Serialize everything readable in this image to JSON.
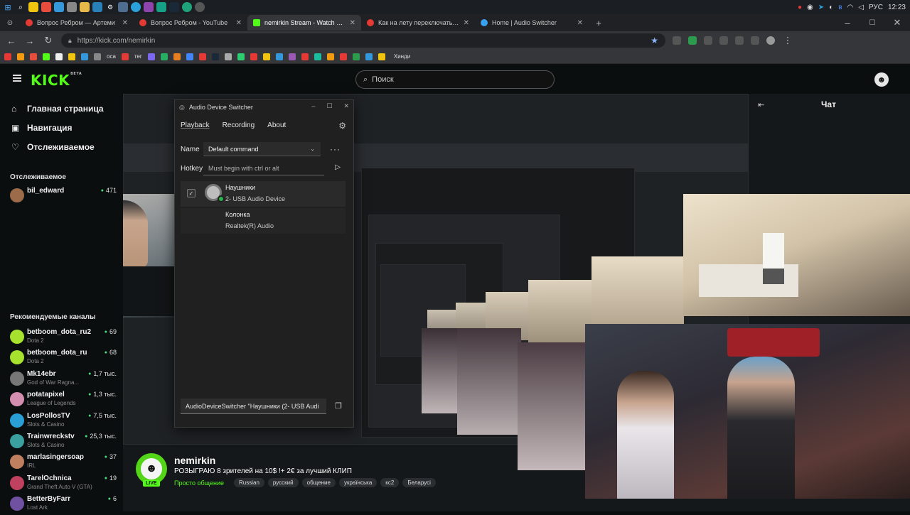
{
  "taskbar": {
    "tray": [
      "РУС",
      "12:23"
    ]
  },
  "browser": {
    "tabs": [
      {
        "title": "Вопрос Ребром — Артеми",
        "color": "#e53935"
      },
      {
        "title": "Вопрос Ребром - YouTube",
        "color": "#e53935"
      },
      {
        "title": "nemirkin Stream - Watch Live on",
        "color": "#53fc18"
      },
      {
        "title": "Как на лету переключать устрой",
        "color": "#e53935"
      },
      {
        "title": "Home | Audio Switcher",
        "color": "#3aa0f0"
      }
    ],
    "url": "https://kick.com/nemirkin",
    "bookmarks": [
      "оса",
      "тег",
      "Хинди"
    ]
  },
  "kick": {
    "logo": "KICK",
    "logo_badge": "BETA",
    "search_placeholder": "Поиск",
    "nav": [
      {
        "label": "Главная страница",
        "icon": "⌂"
      },
      {
        "label": "Навигация",
        "icon": "▣"
      },
      {
        "label": "Отслеживаемое",
        "icon": "♡"
      }
    ],
    "followed_title": "Отслеживаемое",
    "followed": [
      {
        "name": "bil_edward",
        "viewers": "471",
        "color": "#9c6b4a"
      }
    ],
    "recommended_title": "Рекомендуемые каналы",
    "recommended": [
      {
        "name": "betboom_dota_ru2",
        "category": "Dota 2",
        "viewers": "69",
        "color": "#a6e22e"
      },
      {
        "name": "betboom_dota_ru",
        "category": "Dota 2",
        "viewers": "68",
        "color": "#a6e22e"
      },
      {
        "name": "Mk14ebr",
        "category": "God of War Ragna...",
        "viewers": "1,7 тыс.",
        "color": "#777777"
      },
      {
        "name": "potatapixel",
        "category": "League of Legends",
        "viewers": "1,3 тыс.",
        "color": "#d48fb0"
      },
      {
        "name": "LosPollosTV",
        "category": "Slots & Casino",
        "viewers": "7,5 тыс.",
        "color": "#2a9fd6"
      },
      {
        "name": "Trainwreckstv",
        "category": "Slots & Casino",
        "viewers": "25,3 тыс.",
        "color": "#3aa0a0"
      },
      {
        "name": "marlasingersoap",
        "category": "IRL",
        "viewers": "37",
        "color": "#c08060"
      },
      {
        "name": "TarelOchnica",
        "category": "Grand Theft Auto V (GTA)",
        "viewers": "19",
        "color": "#c04060"
      },
      {
        "name": "BetterByFarr",
        "category": "Lost Ark",
        "viewers": "6",
        "color": "#7050a0"
      }
    ],
    "chat_title": "Чат"
  },
  "audio_switcher": {
    "title": "Audio Device Switcher",
    "tabs": [
      "Playback",
      "Recording",
      "About"
    ],
    "name_label": "Name",
    "name_value": "Default command",
    "hotkey_label": "Hotkey",
    "hotkey_placeholder": "Must begin with ctrl or alt",
    "devices": [
      {
        "name": "Наушники",
        "desc": "2- USB Audio Device"
      },
      {
        "name": "Колонка",
        "desc": "Realtek(R) Audio"
      }
    ],
    "command": "AudioDeviceSwitcher \"Наушники (2- USB Audi"
  },
  "stream_info": {
    "streamer": "nemirkin",
    "live": "LIVE",
    "title": "РОЗЫГРАЮ 8 зрителей на 10$ !+ 2€ за лучший КЛИП",
    "category": "Просто общение",
    "tags": [
      "Russian",
      "русский",
      "общение",
      "українська",
      "кс2",
      "Беларусі"
    ]
  }
}
